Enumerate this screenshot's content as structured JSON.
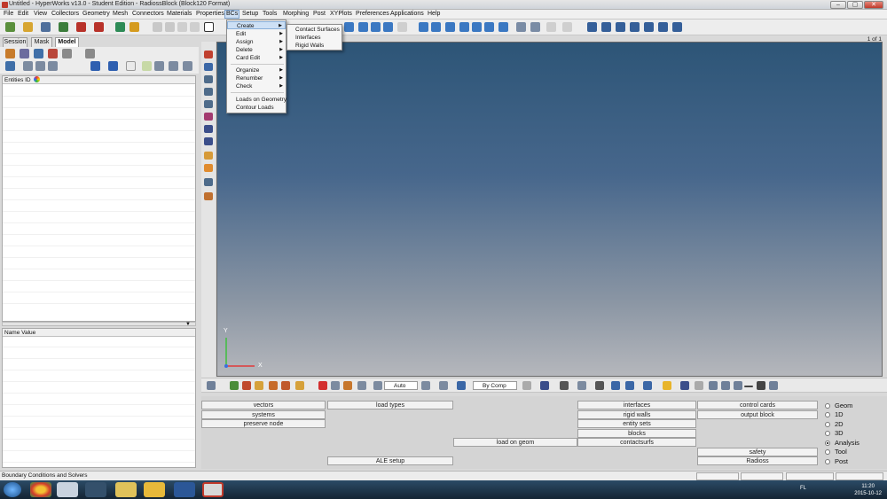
{
  "window": {
    "title": "Untitled - HyperWorks v13.0 - Student Edition - RadiossBlock (Block120 Format)",
    "controls": [
      "–",
      "▢",
      "✕"
    ]
  },
  "menubar": [
    "File",
    "Edit",
    "View",
    "Collectors",
    "Geometry",
    "Mesh",
    "Connectors",
    "Materials",
    "Properties",
    "BCs",
    "Setup",
    "Tools",
    "Morphing",
    "Post",
    "XYPlots",
    "Preferences",
    "Applications",
    "Help"
  ],
  "bcs_menu": {
    "items": [
      {
        "label": "Create",
        "submenu": true,
        "highlighted": true
      },
      {
        "label": "Edit",
        "submenu": true
      },
      {
        "label": "Assign",
        "submenu": true
      },
      {
        "label": "Delete",
        "submenu": true
      },
      {
        "label": "Card Edit",
        "submenu": true
      },
      {
        "label": "Organize",
        "submenu": true
      },
      {
        "label": "Renumber",
        "submenu": true
      },
      {
        "label": "Check",
        "submenu": true
      },
      {
        "label": "Loads on Geometry",
        "submenu": false
      },
      {
        "label": "Contour Loads",
        "submenu": false
      }
    ],
    "create_submenu": [
      "Contact Surfaces",
      "Interfaces",
      "Rigid Walls"
    ]
  },
  "page_indicator": "1 of 1",
  "browser_tabs": [
    "Session",
    "Mask",
    "Model"
  ],
  "entities_header": "Entities ID",
  "name_value_header": "Name Value",
  "axis_labels": {
    "x": "X",
    "y": "Y"
  },
  "bottom_toolbar": {
    "auto_label": "Auto",
    "bycomp_label": "By Comp"
  },
  "panel": {
    "col1": [
      "vectors",
      "systems",
      "preserve node"
    ],
    "col2": [
      "load types",
      "ALE setup"
    ],
    "col3": [
      "load on geom"
    ],
    "col4": [
      "interfaces",
      "rigid walls",
      "entity sets",
      "blocks",
      "contactsurfs"
    ],
    "col5": [
      "control cards",
      "output block",
      "safety",
      "Radioss"
    ]
  },
  "radio_options": [
    {
      "label": "Geom",
      "selected": false
    },
    {
      "label": "1D",
      "selected": false
    },
    {
      "label": "2D",
      "selected": false
    },
    {
      "label": "3D",
      "selected": false
    },
    {
      "label": "Analysis",
      "selected": true
    },
    {
      "label": "Tool",
      "selected": false
    },
    {
      "label": "Post",
      "selected": false
    }
  ],
  "status": "Boundary Conditions and Solvers",
  "taskbar": {
    "lang": "FL",
    "time": "11:20",
    "date": "2015-10-12"
  },
  "colors": {
    "viewport_top": "#2d5577",
    "viewport_bottom": "#b5b7bc",
    "menu_highlight": "#cde0f5"
  }
}
